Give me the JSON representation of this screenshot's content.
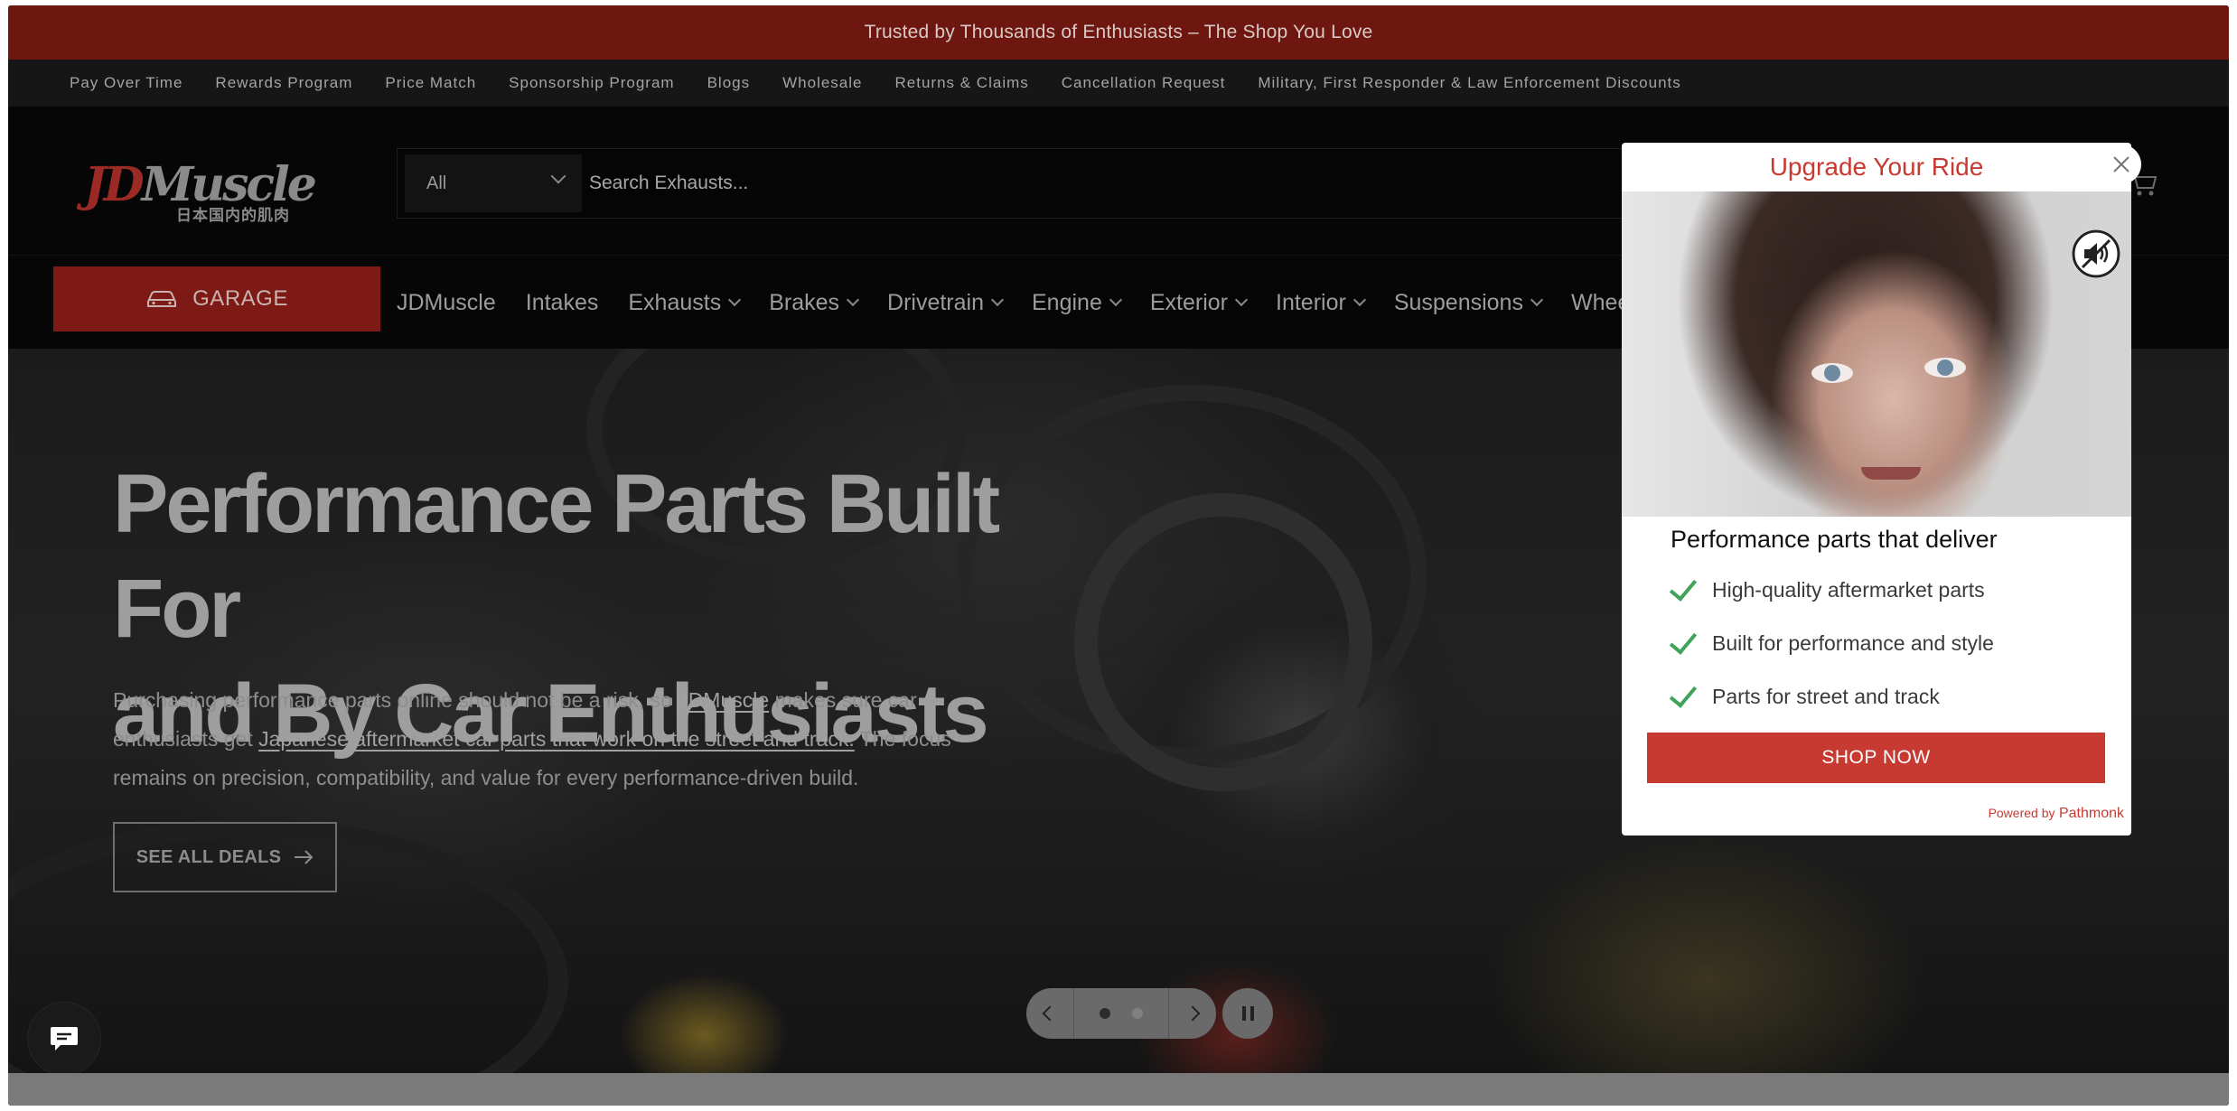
{
  "announcement": "Trusted by Thousands of Enthusiasts – The Shop You Love",
  "utility_links": [
    "Pay Over Time",
    "Rewards Program",
    "Price Match",
    "Sponsorship Program",
    "Blogs",
    "Wholesale",
    "Returns & Claims",
    "Cancellation Request",
    "Military, First Responder & Law Enforcement Discounts"
  ],
  "header": {
    "logo_text": "JDMuscle",
    "logo_subtitle": "日本国内的肌肉",
    "category_selected": "All",
    "search_placeholder": "Search Exhausts..."
  },
  "nav": {
    "garage_label": "GARAGE",
    "items": [
      {
        "label": "JDMuscle",
        "dropdown": false
      },
      {
        "label": "Intakes",
        "dropdown": false
      },
      {
        "label": "Exhausts",
        "dropdown": true
      },
      {
        "label": "Brakes",
        "dropdown": true
      },
      {
        "label": "Drivetrain",
        "dropdown": true
      },
      {
        "label": "Engine",
        "dropdown": true
      },
      {
        "label": "Exterior",
        "dropdown": true
      },
      {
        "label": "Interior",
        "dropdown": true
      },
      {
        "label": "Suspensions",
        "dropdown": true
      },
      {
        "label": "Wheels",
        "dropdown": false
      }
    ]
  },
  "hero": {
    "title_line1": "Performance Parts Built For",
    "title_line2": "and By Car Enthusiasts",
    "body_part1": "Purchasing performance parts online should not be a risk, so ",
    "body_link1": "JDMuscle",
    "body_part2": " makes sure car enthusiasts get ",
    "body_link2": "Japanese aftermarket car parts that work on the street and track.",
    "body_part3": " The focus remains on precision, compatibility, and value for every performance-driven build.",
    "cta_label": "SEE ALL DEALS",
    "slide_count": 2,
    "active_slide": 1
  },
  "popup": {
    "title": "Upgrade Your Ride",
    "heading": "Performance parts that deliver",
    "features": [
      "High-quality aftermarket parts",
      "Built for performance and style",
      "Parts for street and track"
    ],
    "cta_label": "SHOP NOW",
    "powered_prefix": "Powered by",
    "powered_brand": "Pathmonk"
  },
  "colors": {
    "brand_red": "#c73a31",
    "announcement_bg": "#6e1610",
    "check_green": "#3fa35a"
  },
  "icons": [
    "chevron-down-icon",
    "cart-icon",
    "car-icon",
    "arrow-right-icon",
    "chevron-left-icon",
    "chevron-right-icon",
    "pause-icon",
    "chat-icon",
    "close-icon",
    "mute-icon",
    "check-icon"
  ]
}
